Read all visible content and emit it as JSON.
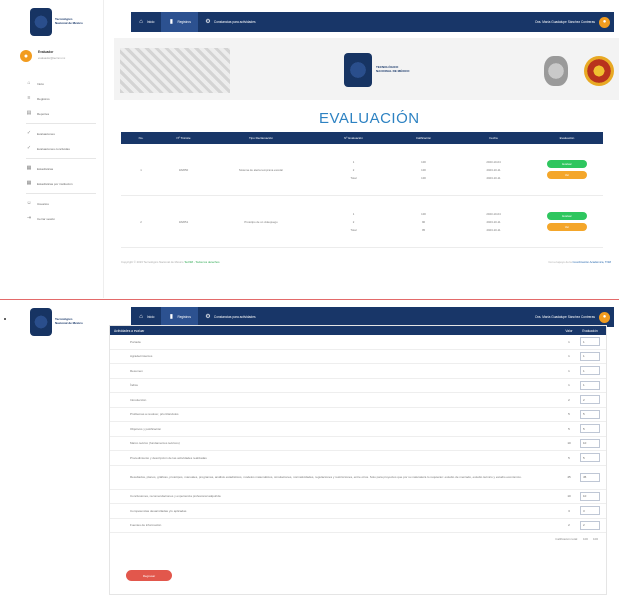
{
  "brand": {
    "logo_text_line1": "Tecnológico",
    "logo_text_line2": "Nacional de México"
  },
  "topbar": {
    "nav_items": [
      {
        "label": "Inicio",
        "icon": "home-icon"
      },
      {
        "label": "Registros",
        "icon": "chart-icon"
      },
      {
        "label": "Constancias para actividades",
        "icon": "gear-icon"
      }
    ],
    "user_label": "Dra. María Guadalupe Sánchez Contreras",
    "user_icon": "bell-icon"
  },
  "sidebar": {
    "profile_name": "Evaluador",
    "profile_sub": "evaluador@tecnm.mx",
    "items": [
      {
        "label": "Inicio",
        "icon": "home-icon"
      },
      {
        "label": "Registros",
        "icon": "list-icon"
      },
      {
        "label": "Reportes",
        "icon": "file-icon"
      },
      {
        "label": "Evaluaciones",
        "icon": "check-icon"
      },
      {
        "label": "Evaluaciones concluidas",
        "icon": "check-icon"
      },
      {
        "label": "Estadísticas",
        "icon": "chart-icon"
      },
      {
        "label": "Estadísticas por institución",
        "icon": "chart-icon"
      },
      {
        "label": "Usuarios",
        "icon": "user-icon"
      },
      {
        "label": "Cerrar sesión",
        "icon": "logout-icon"
      }
    ]
  },
  "banner": {
    "logo_text_line1": "TECNOLÓGICO",
    "logo_text_line2": "NACIONAL DE MÉXICO"
  },
  "evaluation": {
    "title": "EVALUACIÓN",
    "headers": [
      "No.",
      "Nº Trámite",
      "Tipo Reclamación",
      "Nº Evaluación",
      "Calificación",
      "Fecha",
      "Evaluación"
    ],
    "rows": [
      {
        "no": "1",
        "tramite": "182050",
        "tipo": "Sistema de alerta temprana escolar",
        "evaluaciones": [
          "1",
          "2",
          "Total"
        ],
        "calificaciones": [
          "100",
          "100",
          "100"
        ],
        "fechas": [
          "2023-10-04",
          "2023-10-11",
          "2023-10-11"
        ],
        "btn_eval": "Evaluar",
        "btn_ver": "Ver"
      },
      {
        "no": "2",
        "tramite": "182051",
        "tipo": "Prototipo de un videojuego",
        "evaluaciones": [
          "1",
          "2",
          "Total"
        ],
        "calificaciones": [
          "100",
          "90",
          "95"
        ],
        "fechas": [
          "2023-10-04",
          "2023-10-11",
          "2023-10-11"
        ],
        "btn_eval": "Evaluar",
        "btn_ver": "Ver"
      }
    ],
    "footer_left_prefix": "Copyright © 2023 Tecnológico Nacional de México",
    "footer_left_green": "TecNM - Todos los derechos",
    "footer_right_prefix": "Con el apoyo de la",
    "footer_right_blue": "Coordinación Académica, TNM"
  },
  "form": {
    "header_title": "Actividades a evaluar",
    "col_points": "Valor",
    "col_eval": "Evaluación",
    "rows": [
      {
        "label": "Portada",
        "points": "1",
        "value": "1"
      },
      {
        "label": "Agradecimientos",
        "points": "1",
        "value": "1"
      },
      {
        "label": "Resumen",
        "points": "1",
        "value": "1"
      },
      {
        "label": "Índice",
        "points": "1",
        "value": "1"
      },
      {
        "label": "Introducción",
        "points": "2",
        "value": "2"
      },
      {
        "label": "Problemas a resolver, priorizándolos",
        "points": "5",
        "value": "5"
      },
      {
        "label": "Objetivos y justificación",
        "points": "5",
        "value": "5"
      },
      {
        "label": "Marco teórico (fundamentos teóricos)",
        "points": "10",
        "value": "10"
      },
      {
        "label": "Procedimiento y descripción de las actividades realizadas",
        "points": "5",
        "value": "5"
      },
      {
        "label": "Resultados, planos, gráficas, prototipos, manuales, programas, análisis estadísticos, modelos matemáticos, simulaciones, normatividades, regulaciones y restricciones, entre otros. Solo para proyectos que por su naturaleza lo requieran: estudio de mercado, estudio técnico y estudio económico.",
        "points": "45",
        "value": "45",
        "tall": true
      },
      {
        "label": "Conclusiones, recomendaciones y experiencia profesional adquirida",
        "points": "10",
        "value": "10"
      },
      {
        "label": "Competencias desarrolladas y/o aplicadas",
        "points": "3",
        "value": "3"
      },
      {
        "label": "Fuentes de información",
        "points": "2",
        "value": "2"
      }
    ],
    "total_label": "Calificación total:",
    "total_points": "100",
    "total_value": "100",
    "back_button": "Regresar"
  }
}
